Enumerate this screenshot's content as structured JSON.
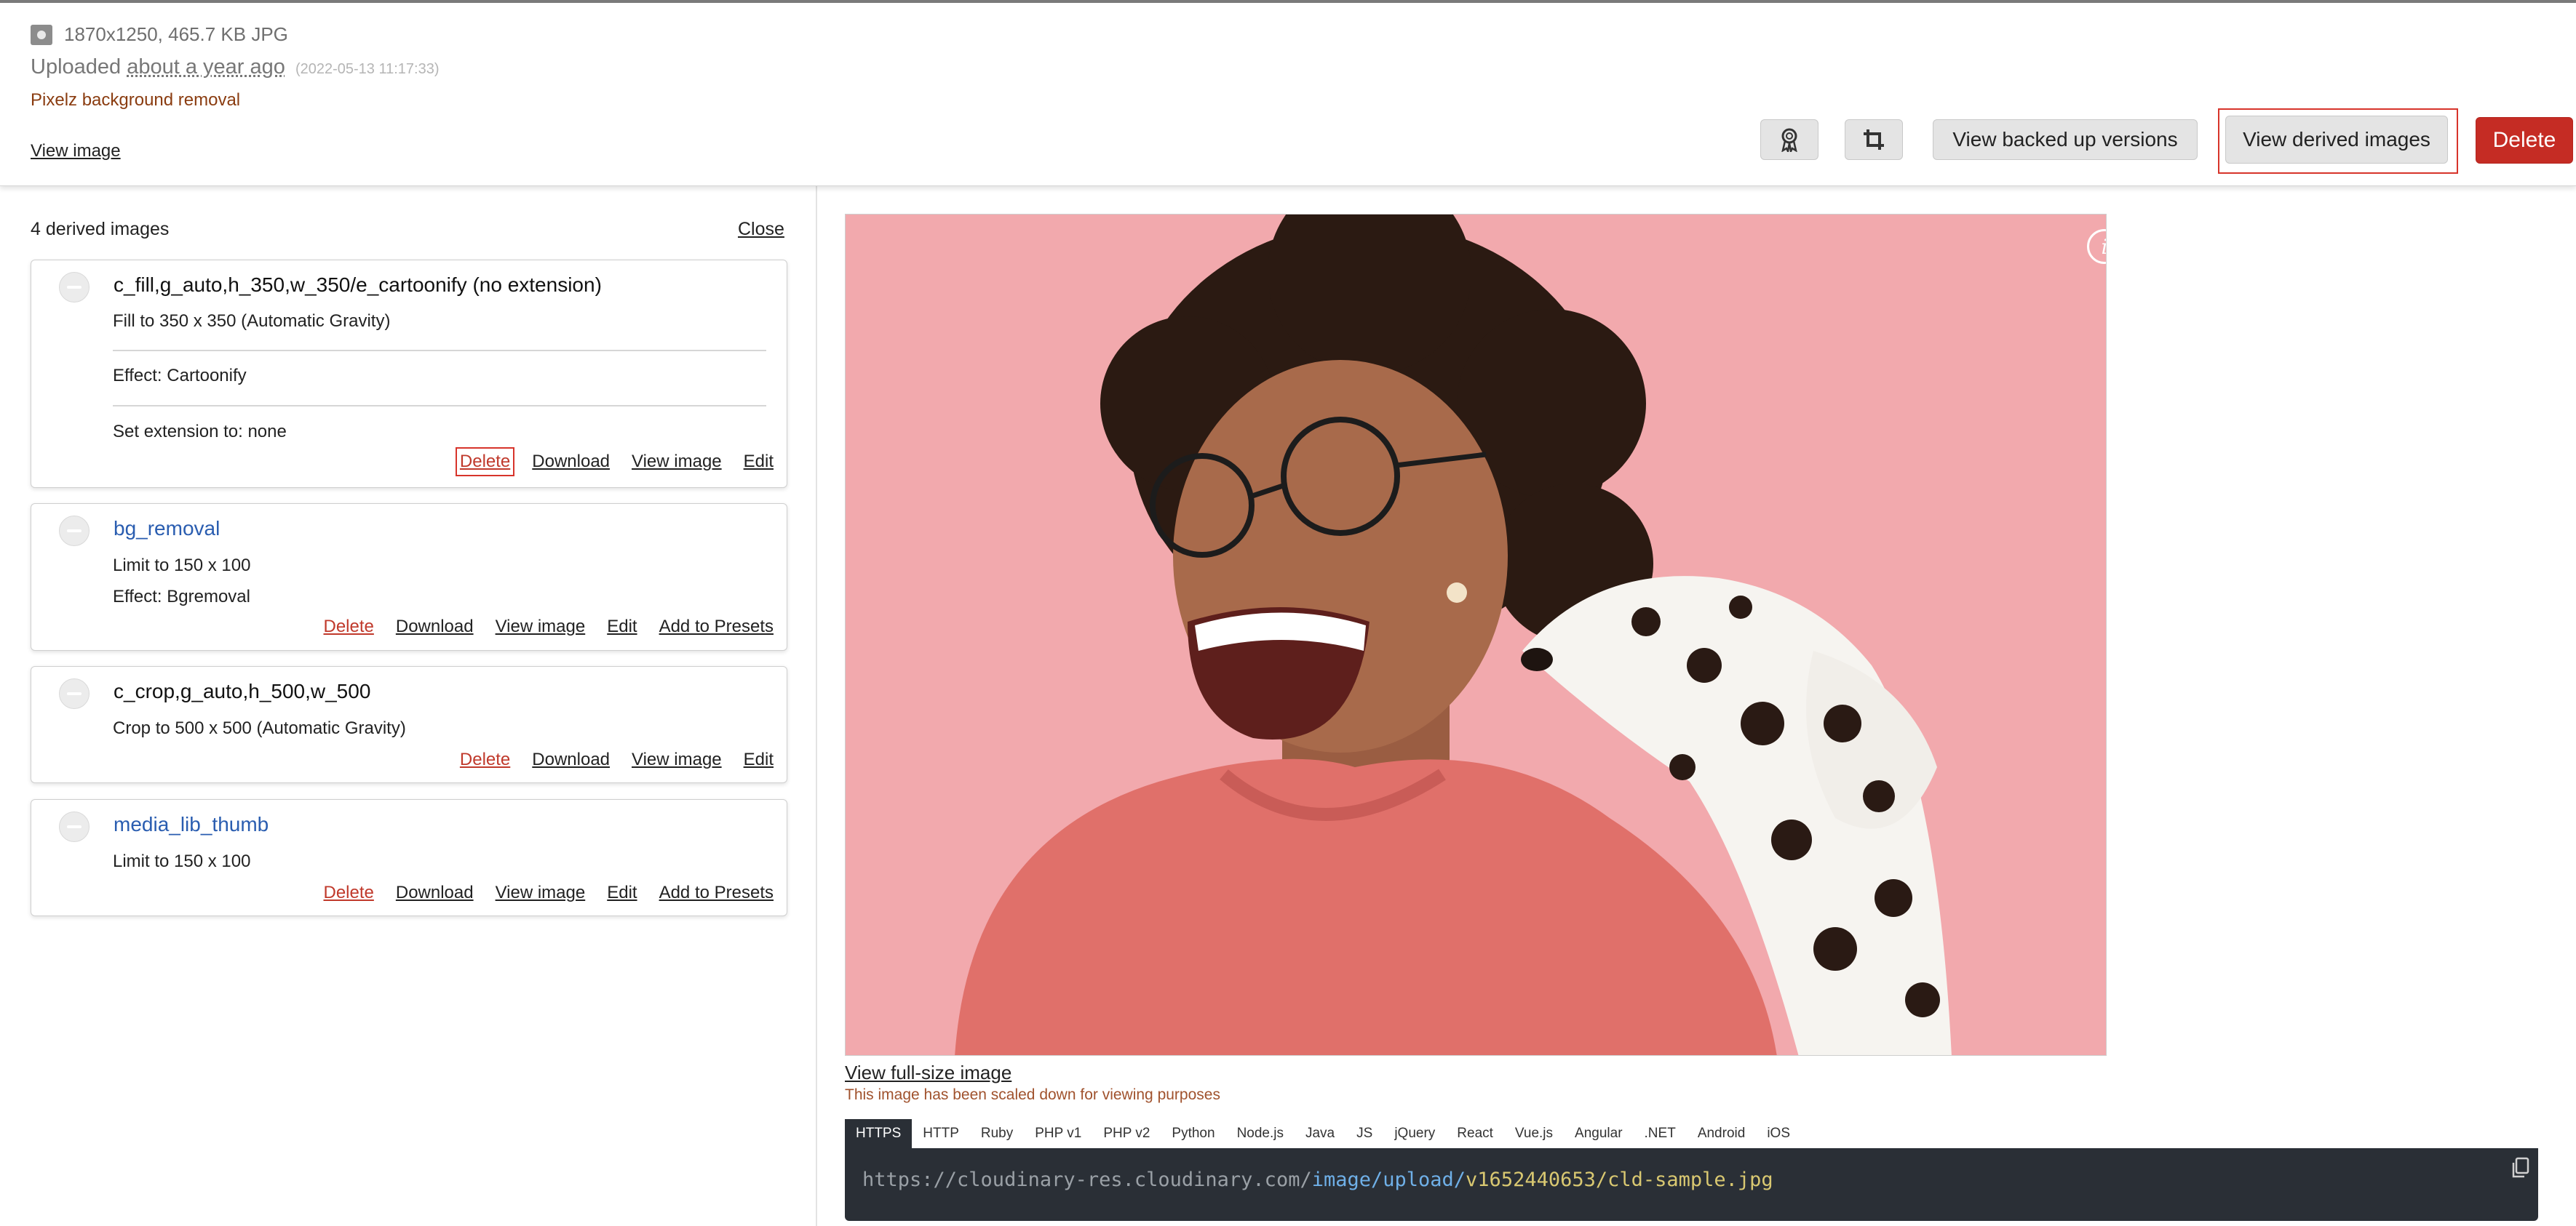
{
  "header": {
    "file_info": "1870x1250, 465.7 KB JPG",
    "uploaded_prefix": "Uploaded",
    "uploaded_ago": "about a year ago",
    "uploaded_timestamp": "(2022-05-13 11:17:33)",
    "addon": "Pixelz background removal",
    "view_image": "View image",
    "buttons": {
      "backed_up": "View backed up versions",
      "derived": "View derived images",
      "delete": "Delete"
    }
  },
  "derived": {
    "count_label": "4 derived images",
    "close": "Close",
    "cards": [
      {
        "title": "c_fill,g_auto,h_350,w_350/e_cartoonify (no extension)",
        "lines": [
          "Fill to 350 x 350 (Automatic Gravity)",
          "Effect: Cartoonify",
          "Set extension to: none"
        ],
        "actions": [
          "Delete",
          "Download",
          "View image",
          "Edit"
        ]
      },
      {
        "title": "bg_removal",
        "lines": [
          "Limit to 150 x 100",
          "Effect: Bgremoval"
        ],
        "actions": [
          "Delete",
          "Download",
          "View image",
          "Edit",
          "Add to Presets"
        ]
      },
      {
        "title": "c_crop,g_auto,h_500,w_500",
        "lines": [
          "Crop to 500 x 500 (Automatic Gravity)"
        ],
        "actions": [
          "Delete",
          "Download",
          "View image",
          "Edit"
        ]
      },
      {
        "title": "media_lib_thumb",
        "lines": [
          "Limit to 150 x 100"
        ],
        "actions": [
          "Delete",
          "Download",
          "View image",
          "Edit",
          "Add to Presets"
        ]
      }
    ]
  },
  "preview": {
    "info_symbol": "i",
    "full_size_link": "View full-size image",
    "scaled_note": "This image has been scaled down for viewing purposes",
    "tabs": [
      "HTTPS",
      "HTTP",
      "Ruby",
      "PHP v1",
      "PHP v2",
      "Python",
      "Node.js",
      "Java",
      "JS",
      "jQuery",
      "React",
      "Vue.js",
      "Angular",
      ".NET",
      "Android",
      "iOS"
    ],
    "active_tab": "HTTPS",
    "url_parts": [
      "https://cloudinary-res.cloudinary.com/",
      "image/upload/",
      "v1652440653/cld-sample.jpg"
    ]
  },
  "colors": {
    "photo_background": "#f2a9ad",
    "delete_red": "#c52c24",
    "code_background": "#2a2f36"
  }
}
